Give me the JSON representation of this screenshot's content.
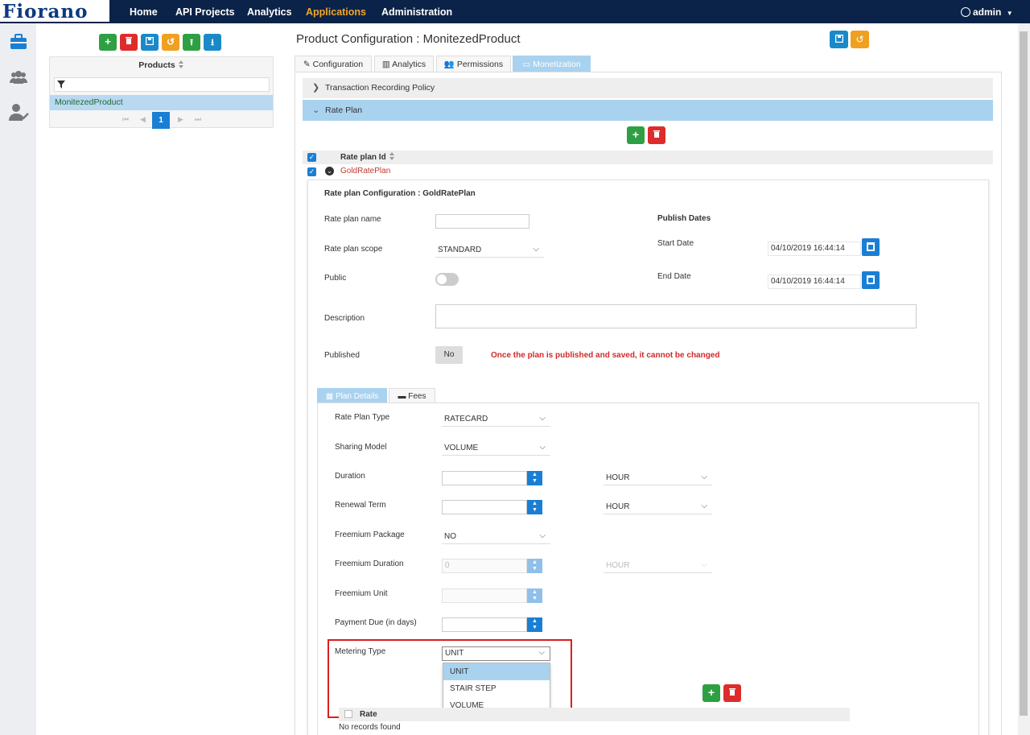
{
  "brand": {
    "logo_text": "Fiorano"
  },
  "nav": {
    "items": [
      "Home",
      "API Projects",
      "Analytics",
      "Applications",
      "Administration"
    ],
    "user": "admin"
  },
  "rail": {
    "icons": [
      "briefcase-icon",
      "users-group-icon",
      "user-check-icon"
    ]
  },
  "products": {
    "header": "Products",
    "rows": [
      "MonitezedProduct"
    ],
    "current_page": "1"
  },
  "main": {
    "title": "Product Configuration : MonitezedProduct",
    "tabs": [
      "Configuration",
      "Analytics",
      "Permissions",
      "Monetization"
    ],
    "transaction_policy": "Transaction Recording Policy",
    "rate_plan": "Rate Plan"
  },
  "rateplans": {
    "column": "Rate plan Id",
    "rows": [
      "GoldRatePlan"
    ]
  },
  "config": {
    "heading": "Rate plan Configuration : GoldRatePlan",
    "name_label": "Rate plan name",
    "name_value": "",
    "scope_label": "Rate plan scope",
    "scope_value": "STANDARD",
    "public_label": "Public",
    "publish_dates": "Publish Dates",
    "start_label": "Start Date",
    "start_value": "04/10/2019 16:44:14",
    "end_label": "End Date",
    "end_value": "04/10/2019 16:44:14",
    "description_label": "Description",
    "published_label": "Published",
    "published_value": "No",
    "warning": "Once the plan is published and saved, it cannot be changed"
  },
  "subtabs": [
    "Plan Details",
    "Fees"
  ],
  "plan": {
    "type_label": "Rate Plan Type",
    "type_value": "RATECARD",
    "sharing_label": "Sharing Model",
    "sharing_value": "VOLUME",
    "duration_label": "Duration",
    "duration_unit": "HOUR",
    "renewal_label": "Renewal Term",
    "renewal_unit": "HOUR",
    "freemium_pkg_label": "Freemium Package",
    "freemium_pkg_value": "NO",
    "freemium_dur_label": "Freemium Duration",
    "freemium_dur_value": "0",
    "freemium_dur_unit": "HOUR",
    "freemium_unit_label": "Freemium Unit",
    "payment_due_label": "Payment Due (in days)",
    "metering_label": "Metering Type",
    "metering_value": "UNIT",
    "metering_options": [
      "UNIT",
      "STAIR STEP",
      "VOLUME"
    ]
  },
  "rates": {
    "column": "Rate",
    "empty": "No records found"
  },
  "colors": {
    "nav_bg": "#0b2348",
    "active_nav": "#f2a62a",
    "accent": "#1a7fd4",
    "add": "#2ea043",
    "delete": "#de2c2c",
    "highlight": "#a9d2ef"
  }
}
